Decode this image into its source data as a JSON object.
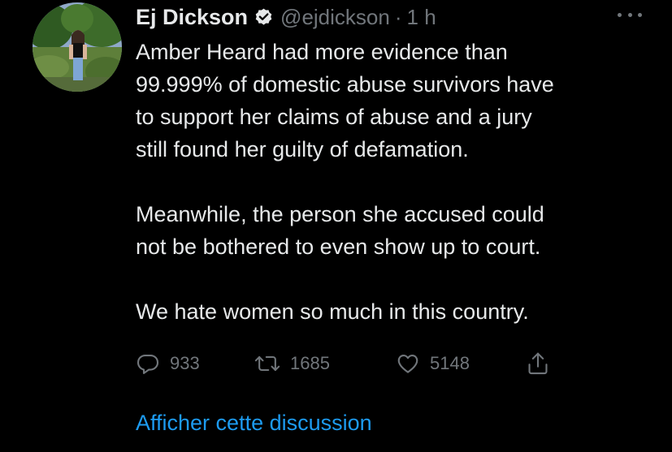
{
  "author": {
    "name": "Ej Dickson",
    "handle": "@ejdickson",
    "separator": "·",
    "time": "1 h",
    "verified": true
  },
  "tweet": {
    "paragraphs": [
      "Amber Heard had more evidence than\n99.999% of domestic abuse survivors have\nto support her claims of abuse and a jury\nstill found her guilty of defamation.",
      "Meanwhile, the person she accused could\nnot be bothered to even show up to court.",
      "We hate women so much in this country."
    ]
  },
  "actions": {
    "replies": "933",
    "retweets": "1685",
    "likes": "5148"
  },
  "thread_link": "Afficher cette discussion",
  "colors": {
    "background": "#000000",
    "text": "#e7e9ea",
    "muted": "#71767b",
    "accent": "#1d9bf0"
  },
  "icons": [
    "verified-badge-icon",
    "more-options-icon",
    "reply-icon",
    "retweet-icon",
    "like-icon",
    "share-icon"
  ]
}
